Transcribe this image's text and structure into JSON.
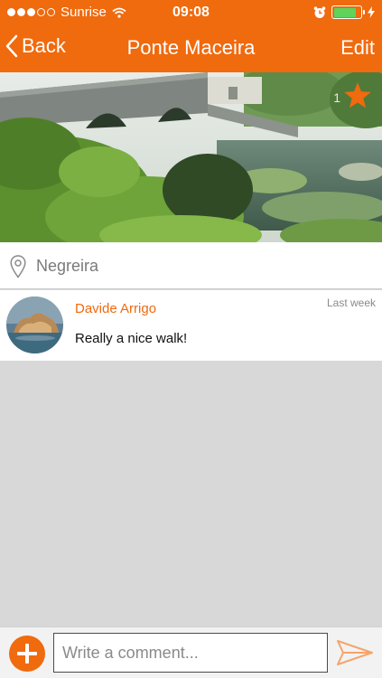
{
  "status_bar": {
    "carrier": "Sunrise",
    "time": "09:08",
    "signal_bars_filled": 3,
    "signal_bars_total": 5,
    "battery_level": 0.85,
    "icons": [
      "wifi-icon",
      "alarm-icon",
      "battery-icon",
      "charging-bolt-icon"
    ]
  },
  "nav": {
    "back_label": "Back",
    "title": "Ponte Maceira",
    "edit_label": "Edit"
  },
  "photo": {
    "favorite_count": "1",
    "icon": "star-icon"
  },
  "location": {
    "icon": "location-pin-icon",
    "name": "Negreira"
  },
  "comments": [
    {
      "author": "Davide Arrigo",
      "time": "Last week",
      "text": "Really a nice walk!"
    }
  ],
  "composer": {
    "placeholder": "Write a comment...",
    "value": "",
    "add_icon": "plus-icon",
    "send_icon": "send-icon"
  },
  "colors": {
    "accent": "#f06a0e",
    "background": "#d8d8d8"
  }
}
